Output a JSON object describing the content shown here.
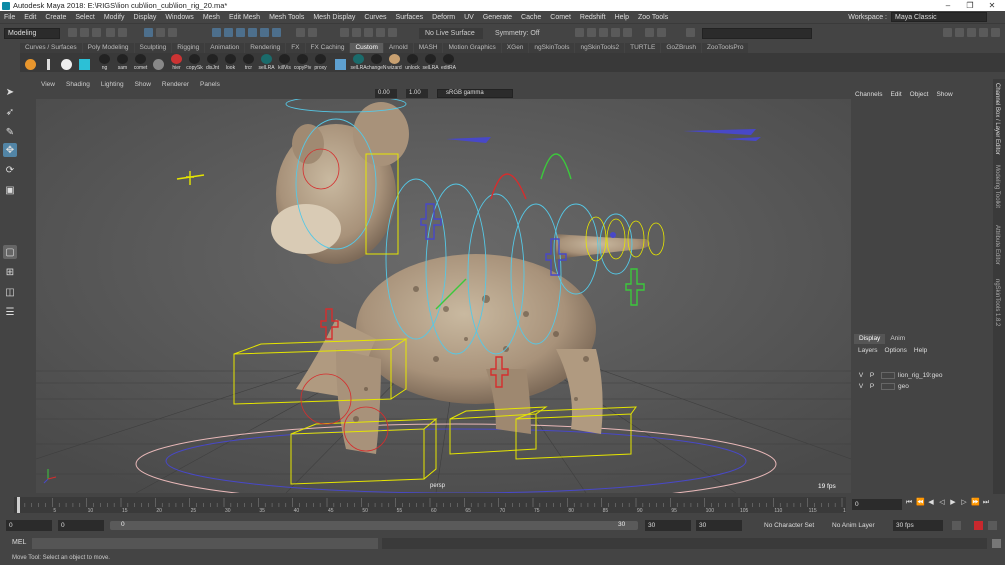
{
  "window": {
    "title": "Autodesk Maya 2018: E:\\RIGS\\lion cub\\lion_cub\\lion_rig_20.ma*",
    "controls": [
      "–",
      "❐",
      "✕"
    ]
  },
  "menubar": {
    "items": [
      "File",
      "Edit",
      "Create",
      "Select",
      "Modify",
      "Display",
      "Windows",
      "Mesh",
      "Edit Mesh",
      "Mesh Tools",
      "Mesh Display",
      "Curves",
      "Surfaces",
      "Deform",
      "UV",
      "Generate",
      "Cache",
      "Comet",
      "Redshift",
      "Help",
      "Zoo Tools"
    ],
    "workspace_label": "Workspace :",
    "workspace_value": "Maya Classic"
  },
  "statusline": {
    "mode": "Modeling",
    "live_surface": "No Live Surface",
    "symmetry": "Symmetry: Off"
  },
  "shelf": {
    "tabs": [
      "Curves / Surfaces",
      "Poly Modeling",
      "Sculpting",
      "Rigging",
      "Animation",
      "Rendering",
      "FX",
      "FX Caching",
      "Custom",
      "Arnold",
      "MASH",
      "Motion Graphics",
      "XGen",
      "ngSkinTools",
      "ngSkinTools2",
      "TURTLE",
      "GoZBrush",
      "ZooToolsPro"
    ],
    "active_tab": "Custom",
    "buttons": [
      "",
      "",
      "",
      "",
      "ng",
      "sam",
      "comet",
      "",
      "hier",
      "copySk",
      "disJnt",
      "look",
      "trcr",
      "selLRA",
      "killVis",
      "copyPiv",
      "proxy",
      "",
      "selLRA",
      "changeN",
      "wizard",
      "unlock",
      "selLRA",
      "editRA"
    ]
  },
  "viewport": {
    "menu": [
      "View",
      "Shading",
      "Lighting",
      "Show",
      "Renderer",
      "Panels"
    ],
    "gamma": "sRGB gamma",
    "exposure": "0.00",
    "gamma_value": "1.00",
    "camera_label": "persp",
    "fps": "19 fps"
  },
  "channelbox": {
    "menu": [
      "Channels",
      "Edit",
      "Object",
      "Show"
    ]
  },
  "layers": {
    "tabs": [
      "Display",
      "Anim"
    ],
    "active_tab": "Display",
    "menu": [
      "Layers",
      "Options",
      "Help"
    ],
    "rows": [
      {
        "v": "V",
        "p": "P",
        "name": "lion_rig_19:geo"
      },
      {
        "v": "V",
        "p": "P",
        "name": "geo"
      }
    ]
  },
  "side_tabs": [
    "Channel Box / Layer Editor",
    "Modeling Toolkit",
    "Attribute Editor",
    "ngSkinTools 1.8.2"
  ],
  "timeline": {
    "current_frame": "0",
    "ticks": [
      "5",
      "10",
      "15",
      "20",
      "25",
      "30",
      "35",
      "40",
      "45",
      "50",
      "55",
      "60",
      "65",
      "70",
      "75",
      "80",
      "85",
      "90",
      "95",
      "100",
      "105",
      "110",
      "115",
      "120"
    ]
  },
  "range": {
    "start": "0",
    "anim_start": "0",
    "slider_start": "0",
    "slider_end": "30",
    "anim_end": "30",
    "end": "30",
    "char_set": "No Character Set",
    "anim_layer": "No Anim Layer",
    "fps": "30 fps"
  },
  "cmdline": {
    "label": "MEL"
  },
  "helpline": {
    "text": "Move Tool: Select an object to move."
  },
  "colors": {
    "viewport_bg": "#5d5d5d",
    "selection_blue": "#5285a6",
    "control_yellow": "#e6e600",
    "control_red": "#d62d2d",
    "control_blue": "#4848c8",
    "control_green": "#3cc83c",
    "control_cyan": "#55c8e6"
  }
}
